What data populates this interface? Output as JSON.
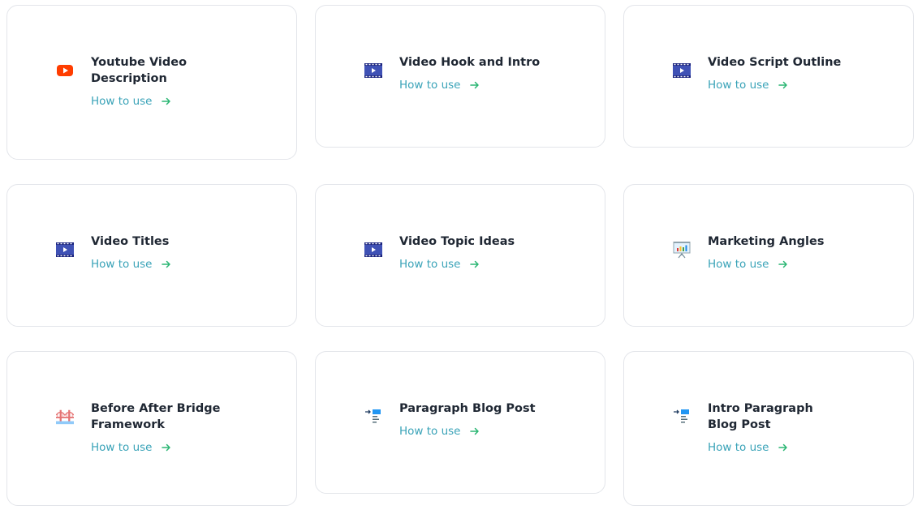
{
  "cards": [
    {
      "title": "Youtube Video Description",
      "link": "How to use",
      "icon": "youtube-icon"
    },
    {
      "title": "Video Hook and Intro",
      "link": "How to use",
      "icon": "film-strip-icon"
    },
    {
      "title": "Video Script Outline",
      "link": "How to use",
      "icon": "film-strip-icon"
    },
    {
      "title": "Video Titles",
      "link": "How to use",
      "icon": "film-strip-icon"
    },
    {
      "title": "Video Topic Ideas",
      "link": "How to use",
      "icon": "film-strip-icon"
    },
    {
      "title": "Marketing Angles",
      "link": "How to use",
      "icon": "presentation-chart-icon"
    },
    {
      "title": "Before After Bridge Framework",
      "link": "How to use",
      "icon": "bridge-icon"
    },
    {
      "title": "Paragraph Blog Post",
      "link": "How to use",
      "icon": "paragraph-indent-icon"
    },
    {
      "title": "Intro Paragraph Blog Post",
      "link": "How to use",
      "icon": "paragraph-indent-icon"
    }
  ],
  "colors": {
    "link": "#3aa3b8",
    "arrow": "#2bb673",
    "title": "#1f2733",
    "border": "#e3e5ea",
    "youtube": "#ff3d00",
    "film": "#3f51b5"
  }
}
